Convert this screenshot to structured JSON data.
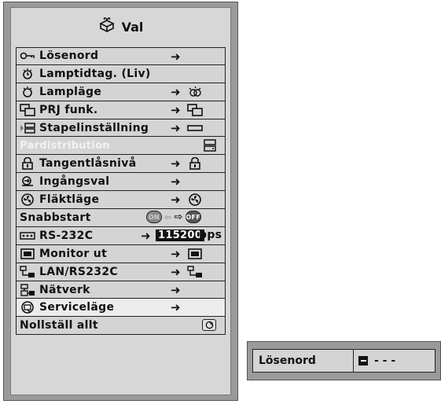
{
  "menu": {
    "title": "Val",
    "title_icon": "gift-box-icon",
    "items": [
      {
        "label": "Lösenord",
        "icon": "key-icon",
        "arrow": "➜"
      },
      {
        "label": "Lamptidtag. (Liv)",
        "icon": "lamp-timer-icon"
      },
      {
        "label": "Lampläge",
        "icon": "lamp-icon",
        "arrow": "➜"
      },
      {
        "label": "PRJ funk.",
        "icon": "projector-screens-icon",
        "arrow": "➜"
      },
      {
        "label": "Stapelinställning",
        "icon": "stack-icon",
        "arrow": "➜"
      },
      {
        "label": "Pardistribution",
        "disabled": true
      },
      {
        "label": "Tangentlåsnivå",
        "icon": "lock-icon",
        "arrow": "➜"
      },
      {
        "label": "Ingångsval",
        "icon": "input-select-icon",
        "arrow": "➜"
      },
      {
        "label": "Fläktläge",
        "icon": "fan-icon",
        "arrow": "➜"
      },
      {
        "label": "Snabbstart",
        "toggle_on": "ON",
        "toggle_off": "OFF"
      },
      {
        "label": "RS-232C",
        "icon": "rs232-port-icon",
        "arrow": "➜",
        "value": "115200",
        "unit": "bps"
      },
      {
        "label": "Monitor ut",
        "icon": "monitor-icon",
        "arrow": "➜"
      },
      {
        "label": "LAN/RS232C",
        "icon": "lan-icon",
        "arrow": "➜"
      },
      {
        "label": "Nätverk",
        "icon": "network-icon",
        "arrow": "➜"
      },
      {
        "label": "Serviceläge",
        "icon": "service-icon",
        "arrow": "➜",
        "selected": true
      },
      {
        "label": "Nollställ allt"
      }
    ]
  },
  "popup": {
    "label": "Lösenord",
    "placeholder_dashes": "- - -"
  }
}
